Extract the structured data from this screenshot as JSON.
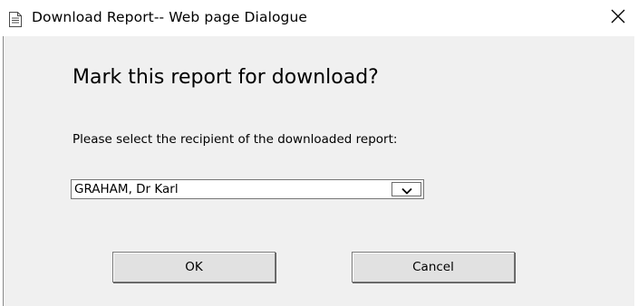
{
  "window": {
    "title": "Download Report-- Web page Dialogue",
    "icon": "document-icon",
    "close_icon": "close-icon"
  },
  "dialog": {
    "heading": "Mark this report for download?",
    "prompt": "Please select the recipient of the downloaded report:",
    "recipient_select": {
      "selected_value": "GRAHAM, Dr Karl",
      "arrow_icon": "chevron-down-icon"
    },
    "buttons": {
      "ok_label": "OK",
      "cancel_label": "Cancel"
    }
  },
  "colors": {
    "content_background": "#f0f0f0",
    "titlebar_background": "#ffffff",
    "button_face": "#e1e1e1"
  }
}
